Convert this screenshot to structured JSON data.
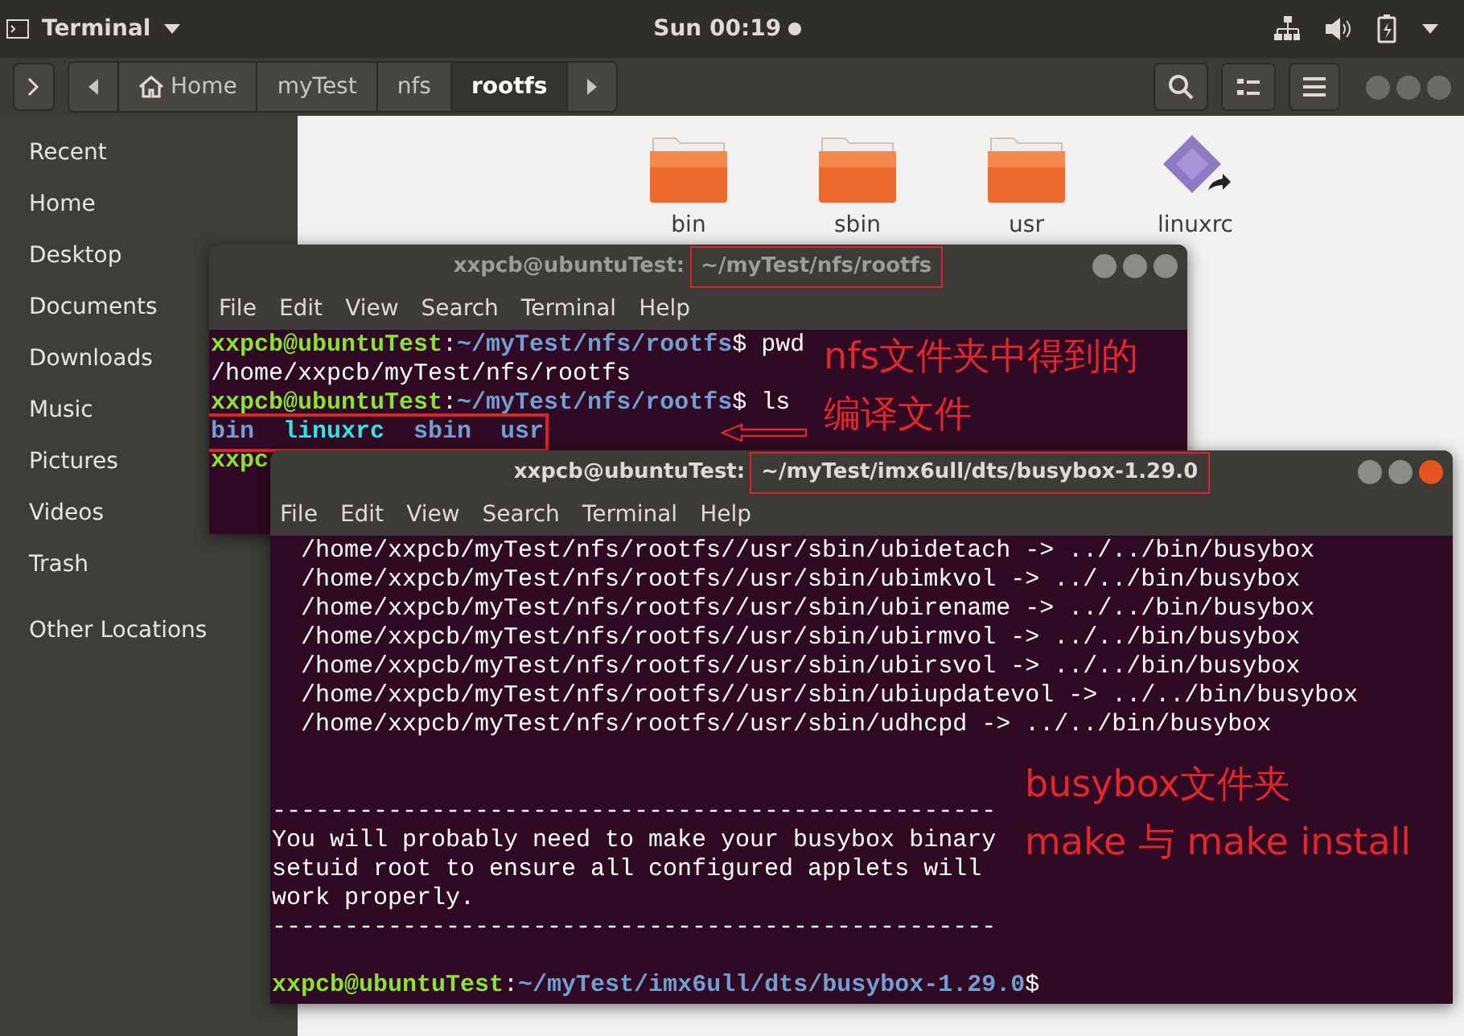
{
  "top_bar": {
    "app_menu": "Terminal",
    "clock": "Sun 00:19"
  },
  "file_manager": {
    "path": [
      {
        "label": "Home",
        "kind": "home",
        "selected": false
      },
      {
        "label": "myTest",
        "kind": "folder",
        "selected": false
      },
      {
        "label": "nfs",
        "kind": "folder",
        "selected": false
      },
      {
        "label": "rootfs",
        "kind": "folder",
        "selected": true
      }
    ],
    "sidebar": [
      {
        "label": "Recent"
      },
      {
        "label": "Home"
      },
      {
        "label": "Desktop"
      },
      {
        "label": "Documents"
      },
      {
        "label": "Downloads"
      },
      {
        "label": "Music"
      },
      {
        "label": "Pictures"
      },
      {
        "label": "Videos"
      },
      {
        "label": "Trash"
      },
      {
        "label": "Other Locations",
        "kind": "separated"
      }
    ],
    "files": [
      {
        "name": "bin",
        "kind": "folder"
      },
      {
        "name": "sbin",
        "kind": "folder"
      },
      {
        "name": "usr",
        "kind": "folder"
      },
      {
        "name": "linuxrc",
        "kind": "link"
      }
    ]
  },
  "terminals": [
    {
      "title_prefix": "xxpcb@ubuntuTest:",
      "title_path": "~/myTest/nfs/rootfs",
      "path_highlighted": true,
      "focused": false,
      "menu": [
        "File",
        "Edit",
        "View",
        "Search",
        "Terminal",
        "Help"
      ],
      "lines": [
        {
          "segments": [
            {
              "text": "xxpcb@ubuntuTest",
              "kind": "user"
            },
            {
              "text": ":",
              "kind": "plain"
            },
            {
              "text": "~/myTest/nfs/rootfs",
              "kind": "path"
            },
            {
              "text": "$ pwd",
              "kind": "plain"
            }
          ]
        },
        {
          "segments": [
            {
              "text": "/home/xxpcb/myTest/nfs/rootfs",
              "kind": "plain"
            }
          ]
        },
        {
          "segments": [
            {
              "text": "xxpcb@ubuntuTest",
              "kind": "user"
            },
            {
              "text": ":",
              "kind": "plain"
            },
            {
              "text": "~/myTest/nfs/rootfs",
              "kind": "path"
            },
            {
              "text": "$ ls",
              "kind": "plain"
            }
          ]
        },
        {
          "highlighted": true,
          "kind": "listing",
          "segments": [
            {
              "text": "bin",
              "kind": "dir"
            },
            {
              "text": "linuxrc",
              "kind": "link"
            },
            {
              "text": "sbin",
              "kind": "dir"
            },
            {
              "text": "usr",
              "kind": "dir"
            }
          ]
        },
        {
          "segments": [
            {
              "text": "xxpc",
              "kind": "user"
            }
          ]
        }
      ],
      "notes": [
        {
          "lines": [
            "nfs文件夹中得到的",
            "编译文件"
          ],
          "arrow": true
        }
      ]
    },
    {
      "title_prefix": "xxpcb@ubuntuTest:",
      "title_path": "~/myTest/imx6ull/dts/busybox-1.29.0",
      "path_highlighted": true,
      "focused": true,
      "menu": [
        "File",
        "Edit",
        "View",
        "Search",
        "Terminal",
        "Help"
      ],
      "lines": [
        {
          "segments": [
            {
              "text": "  /home/xxpcb/myTest/nfs/rootfs//usr/sbin/ubidetach -> ../../bin/busybox",
              "kind": "plain"
            }
          ]
        },
        {
          "segments": [
            {
              "text": "  /home/xxpcb/myTest/nfs/rootfs//usr/sbin/ubimkvol -> ../../bin/busybox",
              "kind": "plain"
            }
          ]
        },
        {
          "segments": [
            {
              "text": "  /home/xxpcb/myTest/nfs/rootfs//usr/sbin/ubirename -> ../../bin/busybox",
              "kind": "plain"
            }
          ]
        },
        {
          "segments": [
            {
              "text": "  /home/xxpcb/myTest/nfs/rootfs//usr/sbin/ubirmvol -> ../../bin/busybox",
              "kind": "plain"
            }
          ]
        },
        {
          "segments": [
            {
              "text": "  /home/xxpcb/myTest/nfs/rootfs//usr/sbin/ubirsvol -> ../../bin/busybox",
              "kind": "plain"
            }
          ]
        },
        {
          "segments": [
            {
              "text": "  /home/xxpcb/myTest/nfs/rootfs//usr/sbin/ubiupdatevol -> ../../bin/busybox",
              "kind": "plain"
            }
          ]
        },
        {
          "segments": [
            {
              "text": "  /home/xxpcb/myTest/nfs/rootfs//usr/sbin/udhcpd -> ../../bin/busybox",
              "kind": "plain"
            }
          ]
        },
        {
          "kind": "blank"
        },
        {
          "kind": "blank"
        },
        {
          "segments": [
            {
              "text": "--------------------------------------------------",
              "kind": "plain"
            }
          ]
        },
        {
          "segments": [
            {
              "text": "You will probably need to make your busybox binary",
              "kind": "plain"
            }
          ]
        },
        {
          "segments": [
            {
              "text": "setuid root to ensure all configured applets will",
              "kind": "plain"
            }
          ]
        },
        {
          "segments": [
            {
              "text": "work properly.",
              "kind": "plain"
            }
          ]
        },
        {
          "segments": [
            {
              "text": "--------------------------------------------------",
              "kind": "plain"
            }
          ]
        },
        {
          "kind": "blank"
        },
        {
          "segments": [
            {
              "text": "xxpcb@ubuntuTest",
              "kind": "user"
            },
            {
              "text": ":",
              "kind": "plain"
            },
            {
              "text": "~/myTest/imx6ull/dts/busybox-1.29.0",
              "kind": "path"
            },
            {
              "text": "$",
              "kind": "plain"
            }
          ]
        }
      ],
      "notes": [
        {
          "lines": [
            "busybox文件夹",
            "make 与 make install"
          ]
        }
      ]
    }
  ]
}
